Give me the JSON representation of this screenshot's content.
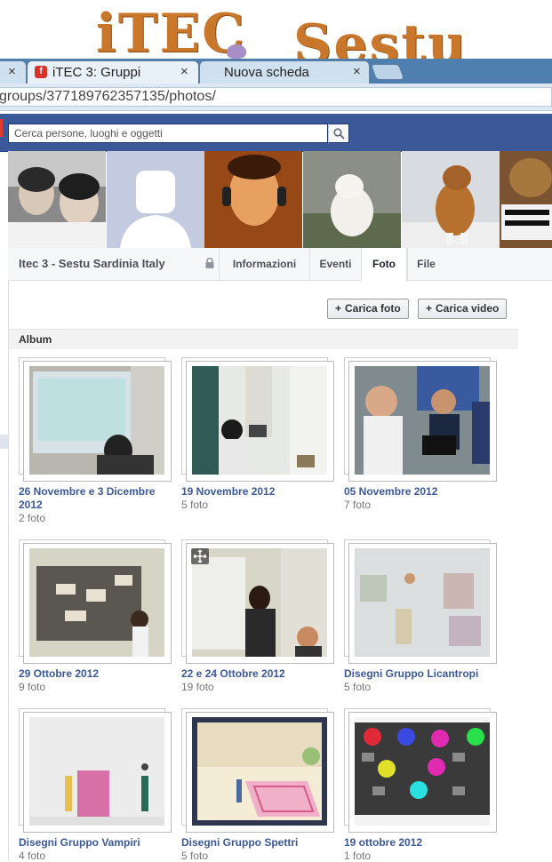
{
  "browser": {
    "tabs": [
      {
        "label": "",
        "close": "×"
      },
      {
        "label": "iTEC 3: Gruppi",
        "close": "×",
        "favicon": "iTEC",
        "active": true
      },
      {
        "label": "Nuova scheda",
        "close": "×"
      }
    ],
    "url": "groups/377189762357135/photos/"
  },
  "header": {
    "search_placeholder": "Cerca persone, luoghi e oggetti",
    "brand_color": "#3b5998"
  },
  "group": {
    "name": "Itec 3 - Sestu Sardinia Italy",
    "tabs": [
      "Informazioni",
      "Eventi",
      "Foto",
      "File"
    ],
    "active_tab": "Foto"
  },
  "actions": {
    "upload_photo": "Carica foto",
    "upload_video": "Carica video"
  },
  "section_title": "Album",
  "albums": [
    {
      "title": "26 Novembre e 3 Dicembre 2012",
      "count": "2 foto"
    },
    {
      "title": "19 Novembre 2012",
      "count": "5 foto"
    },
    {
      "title": "05 Novembre 2012",
      "count": "7 foto"
    },
    {
      "title": "29 Ottobre 2012",
      "count": "9 foto"
    },
    {
      "title": "22 e 24 Ottobre 2012",
      "count": "19 foto"
    },
    {
      "title": "Disegni Gruppo Licantropi",
      "count": "5 foto"
    },
    {
      "title": "Disegni Gruppo Vampiri",
      "count": "4 foto"
    },
    {
      "title": "Disegni Gruppo Spettri",
      "count": "5 foto"
    },
    {
      "title": "19 ottobre 2012",
      "count": "1 foto"
    }
  ]
}
